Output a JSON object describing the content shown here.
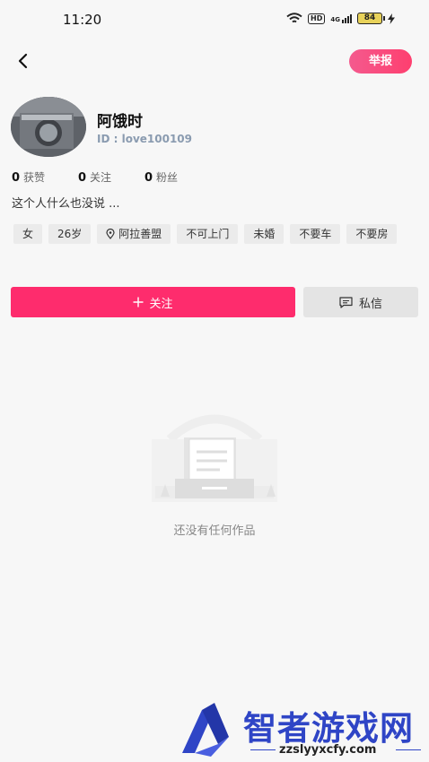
{
  "status_bar": {
    "time": "11:20",
    "network": "4G",
    "hd": "HD",
    "battery": "84"
  },
  "header": {
    "report_label": "举报"
  },
  "profile": {
    "nickname": "阿饿时",
    "user_id": "ID : love100109",
    "stats": [
      {
        "num": "0",
        "label": "获赞"
      },
      {
        "num": "0",
        "label": "关注"
      },
      {
        "num": "0",
        "label": "粉丝"
      }
    ],
    "bio": "这个人什么也没说 ...",
    "tags": [
      "女",
      "26岁",
      "阿拉善盟",
      "不可上门",
      "未婚",
      "不要车",
      "不要房"
    ]
  },
  "actions": {
    "follow_label": "关注",
    "message_label": "私信"
  },
  "empty_state": {
    "text": "还没有任何作品"
  },
  "watermark": {
    "title": "智者游戏网",
    "url": "zzslyyxcfy.com"
  },
  "colors": {
    "accent": "#fe2c6d",
    "report": "#f45a8e",
    "watermark": "#2f45c6"
  }
}
